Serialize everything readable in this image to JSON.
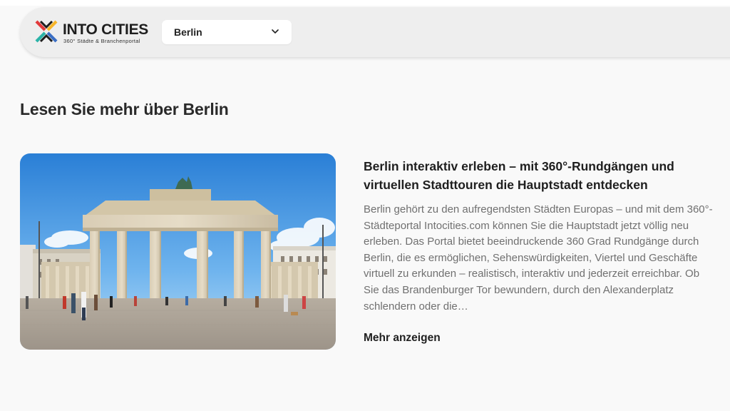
{
  "header": {
    "logo": {
      "name": "INTO CITIES",
      "tagline": "360° Städte & Branchenportal",
      "colors": [
        "#e2393b",
        "#f7b52a",
        "#2bb3a8",
        "#3a6ec4",
        "#1e1e1e"
      ]
    },
    "city_select": {
      "value": "Berlin",
      "icon": "chevron-down-icon"
    }
  },
  "main": {
    "title": "Lesen Sie mehr über Berlin",
    "article": {
      "image_subject": "Brandenburg Gate",
      "title": "Berlin interaktiv erleben – mit 360°-Rundgängen und virtuellen Stadttouren die Hauptstadt entdecken",
      "body": "Berlin gehört zu den aufregendsten Städten Europas – und mit dem 360°-Städteportal Intocities.com können Sie die Hauptstadt jetzt völlig neu erleben. Das Portal bietet beeindruckende 360 Grad Rundgänge durch Berlin, die es ermöglichen, Sehenswürdigkeiten, Viertel und Geschäfte virtuell zu erkunden – realistisch, interaktiv und jederzeit erreichbar.  Ob Sie das Brandenburger Tor bewundern, durch den Alexanderplatz schlendern oder die…",
      "more_label": "Mehr anzeigen"
    }
  }
}
